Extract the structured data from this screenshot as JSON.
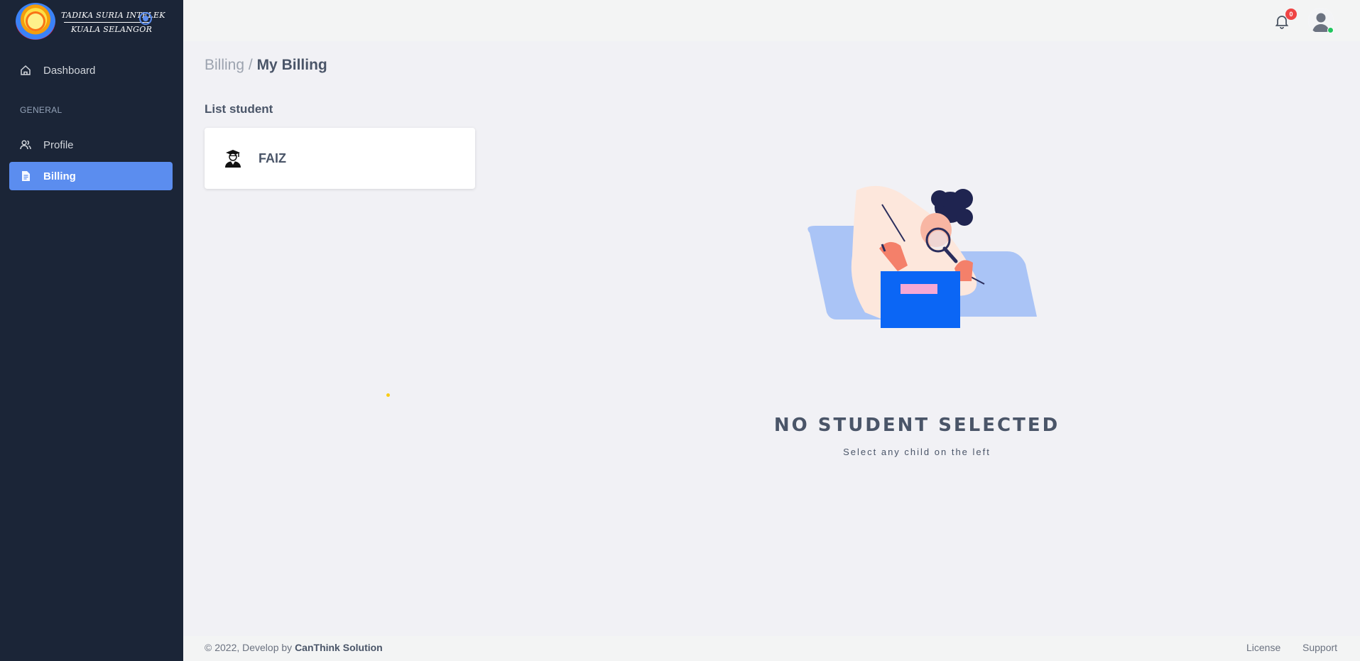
{
  "brand": {
    "line1": "TADIKA SURIA INTELEK",
    "line2": "KUALA SELANGOR"
  },
  "sidebar": {
    "items": [
      {
        "label": "Dashboard",
        "icon": "home-icon"
      },
      {
        "label": "Profile",
        "icon": "users-icon"
      },
      {
        "label": "Billing",
        "icon": "document-icon",
        "active": true
      }
    ],
    "section_label": "GENERAL"
  },
  "header": {
    "notification_count": "0"
  },
  "breadcrumb": {
    "root": "Billing",
    "separator": "/",
    "current": "My Billing"
  },
  "students": {
    "title": "List student",
    "items": [
      {
        "name": "FAIZ",
        "icon": "graduate-icon"
      }
    ]
  },
  "empty_state": {
    "title": "NO STUDENT SELECTED",
    "subtitle": "Select any child on the left"
  },
  "footer": {
    "copyright": "© 2022, Develop by",
    "company": "CanThink Solution",
    "links": [
      "License",
      "Support"
    ]
  },
  "colors": {
    "sidebar_bg": "#1b2537",
    "accent": "#5b8def",
    "badge": "#ef4444",
    "online": "#22c55e"
  }
}
